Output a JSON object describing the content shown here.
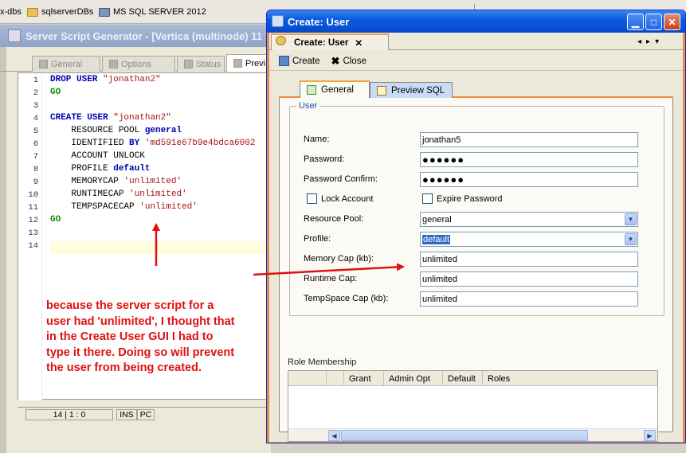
{
  "taskbar": {
    "items": [
      "x-dbs",
      "sqlserverDBs",
      "MS SQL SERVER 2012"
    ]
  },
  "generator": {
    "title": "Server Script Generator - [Vertica (multinode) 11",
    "tabs": [
      "General",
      "Options",
      "Status",
      "Previ"
    ],
    "line_numbers": [
      "1",
      "2",
      "3",
      "4",
      "5",
      "6",
      "7",
      "8",
      "9",
      "10",
      "11",
      "12",
      "13",
      "14"
    ],
    "status": {
      "position": "14 | 1 : 0",
      "ins": "INS",
      "pc": "PC"
    }
  },
  "annotation": {
    "text": "because the server script for a user had 'unlimited', I thought that in the Create User GUI I had to type it there. Doing so will prevent the user from being created."
  },
  "dialog": {
    "title": "Create: User",
    "doc_tab": "Create: User",
    "doc_tab_close": "✕",
    "nav": [
      "◂",
      "▸",
      "▾"
    ],
    "toolbar": {
      "create": "Create",
      "close": "Close"
    },
    "tabs": {
      "general": "General",
      "preview": "Preview SQL"
    },
    "group_title": "User",
    "fields": {
      "name": {
        "label": "Name:",
        "value": "jonathan5"
      },
      "password": {
        "label": "Password:",
        "value": "●●●●●●"
      },
      "password_confirm": {
        "label": "Password Confirm:",
        "value": "●●●●●●"
      },
      "lock_account": {
        "label": "Lock Account",
        "checked": false
      },
      "expire_password": {
        "label": "Expire Password",
        "checked": false
      },
      "resource_pool": {
        "label": "Resource Pool:",
        "value": "general"
      },
      "profile": {
        "label": "Profile:",
        "value": "default"
      },
      "memory_cap": {
        "label": "Memory Cap (kb):",
        "value": "unlimited"
      },
      "runtime_cap": {
        "label": "Runtime Cap:",
        "value": "unlimited"
      },
      "tempspace_cap": {
        "label": "TempSpace Cap (kb):",
        "value": "unlimited"
      }
    },
    "role_membership": {
      "title": "Role Membership",
      "columns": [
        "",
        "",
        "Grant",
        "Admin Opt",
        "Default",
        "Roles"
      ]
    }
  },
  "colors": {
    "annotation": "#e01010",
    "accent": "#f0883c",
    "title_bar": "#0a5ade"
  }
}
